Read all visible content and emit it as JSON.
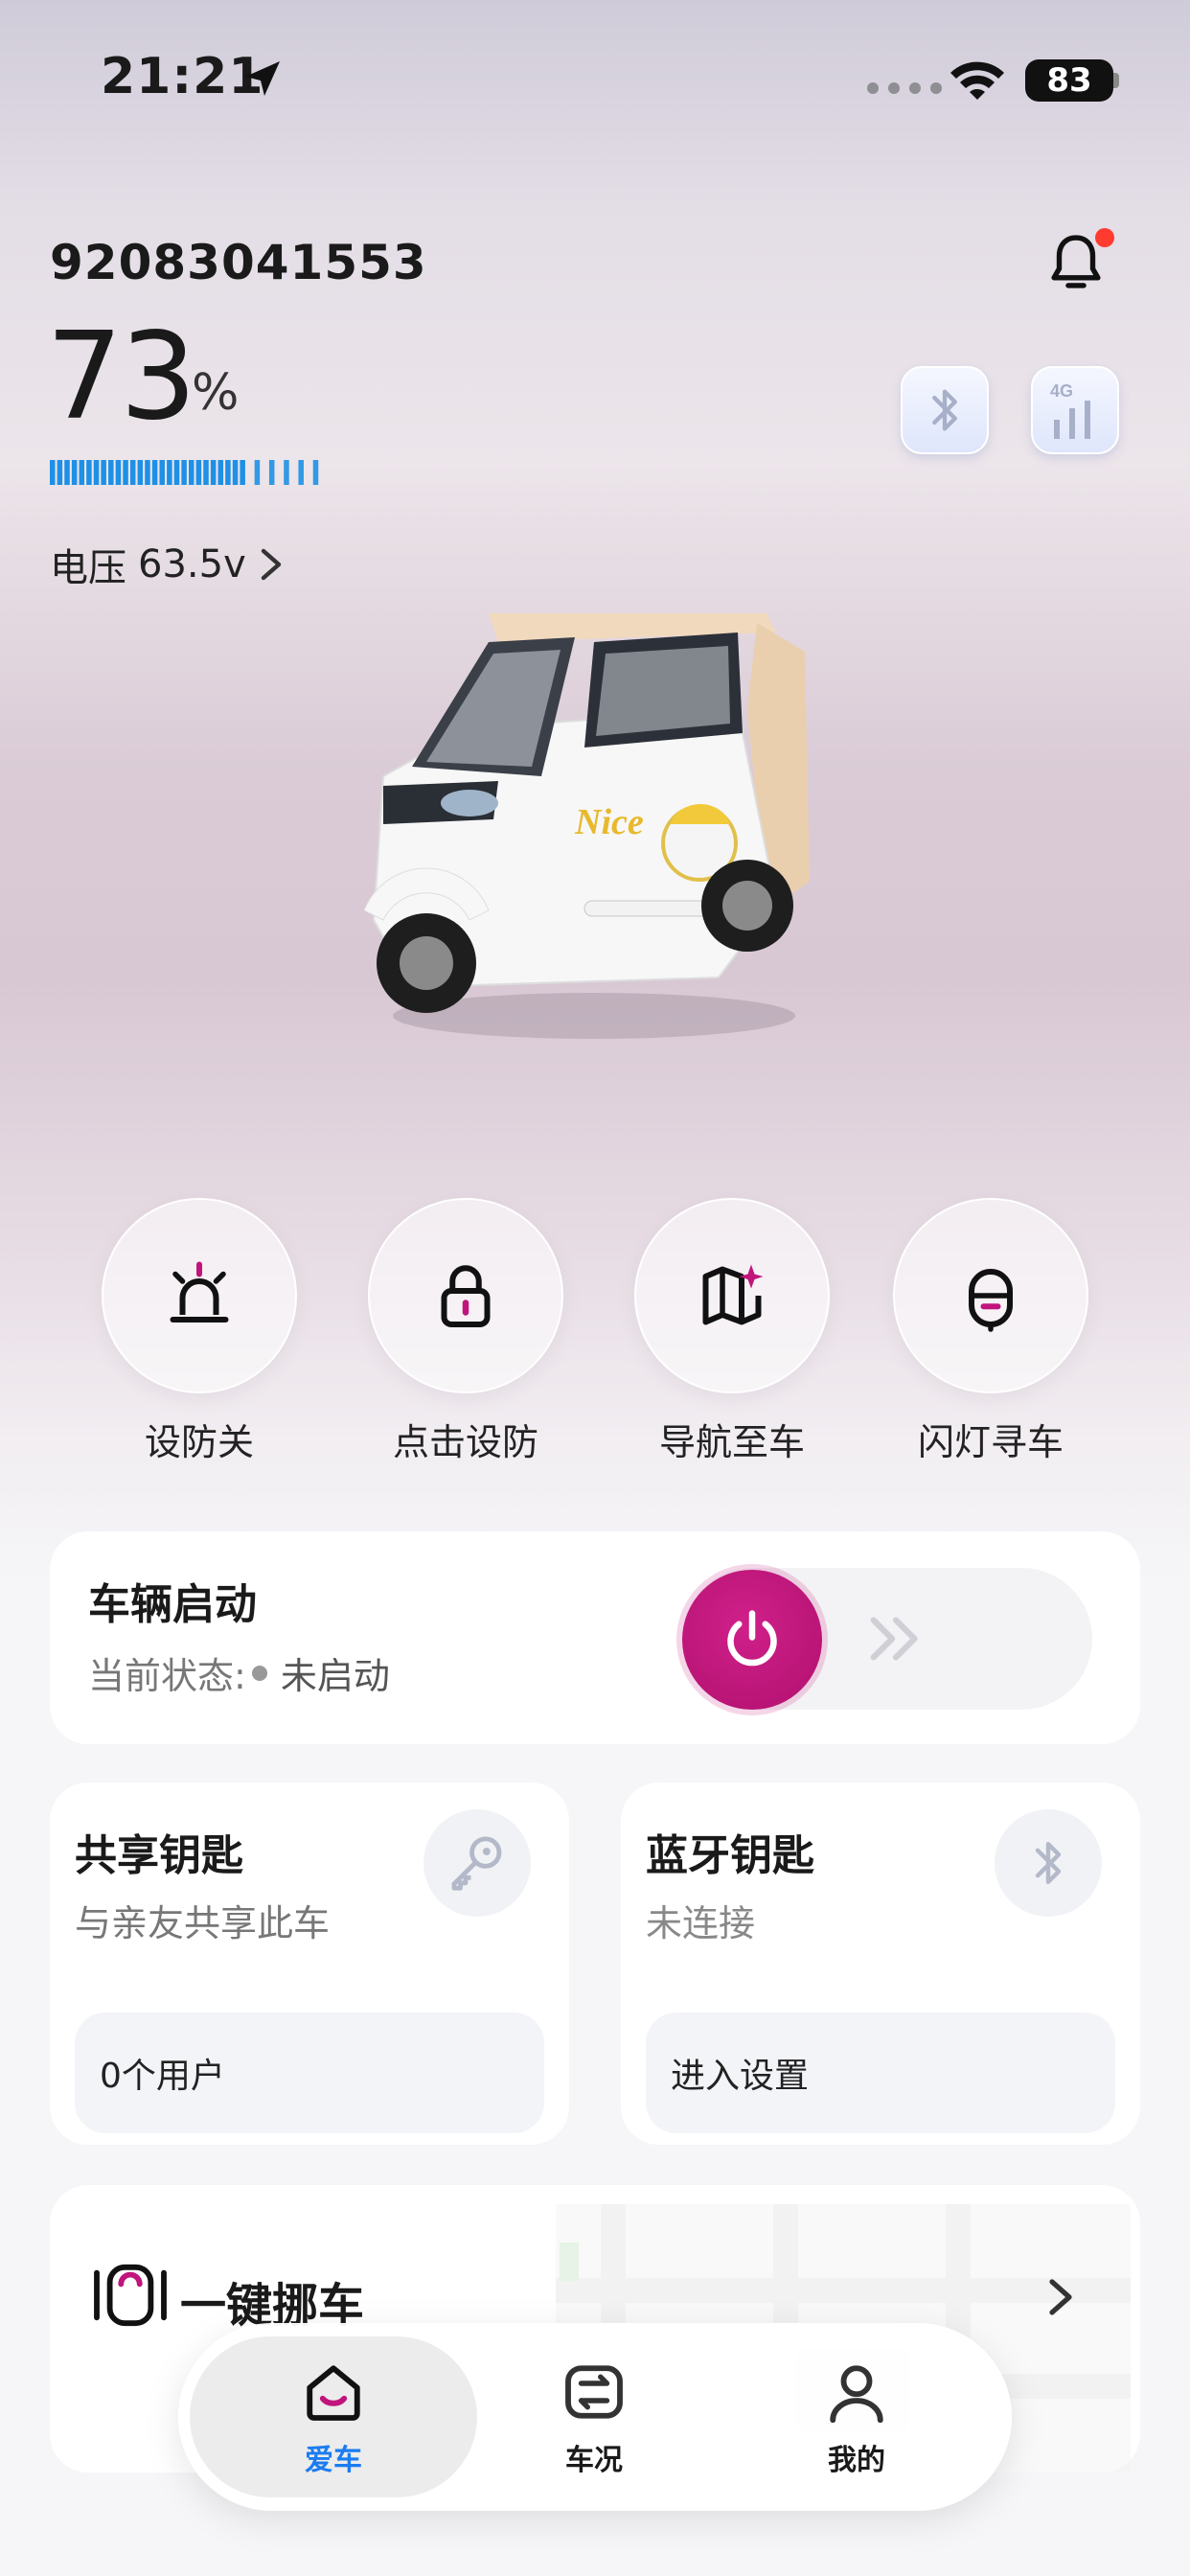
{
  "status_bar": {
    "time": "21:21",
    "battery": "83"
  },
  "vehicle": {
    "id": "92083041553",
    "battery_percent": "73",
    "battery_unit": "%",
    "battery_level": 0.73,
    "voltage_label": "电压",
    "voltage_value": "63.5v"
  },
  "quick_actions": [
    {
      "label": "设防关",
      "icon": "alarm-light-icon"
    },
    {
      "label": "点击设防",
      "icon": "lock-icon"
    },
    {
      "label": "导航至车",
      "icon": "map-sparkle-icon"
    },
    {
      "label": "闪灯寻车",
      "icon": "find-car-light-icon"
    }
  ],
  "start_card": {
    "title": "车辆启动",
    "status_label": "当前状态:",
    "status_value": "未启动"
  },
  "share_card": {
    "title": "共享钥匙",
    "subtitle": "与亲友共享此车",
    "pill": "0个用户"
  },
  "bt_card": {
    "title": "蓝牙钥匙",
    "subtitle": "未连接",
    "pill": "进入设置"
  },
  "move_card": {
    "title": "一键挪车"
  },
  "tabs": [
    {
      "label": "爱车",
      "active": true,
      "color": "#1b7cf0"
    },
    {
      "label": "车况",
      "active": false,
      "color": "#1a1a1a"
    },
    {
      "label": "我的",
      "active": false,
      "color": "#1a1a1a"
    }
  ],
  "colors": {
    "accent": "#c0157c",
    "battery_bar": "#1e90e6",
    "tab_active": "#1b7cf0"
  }
}
